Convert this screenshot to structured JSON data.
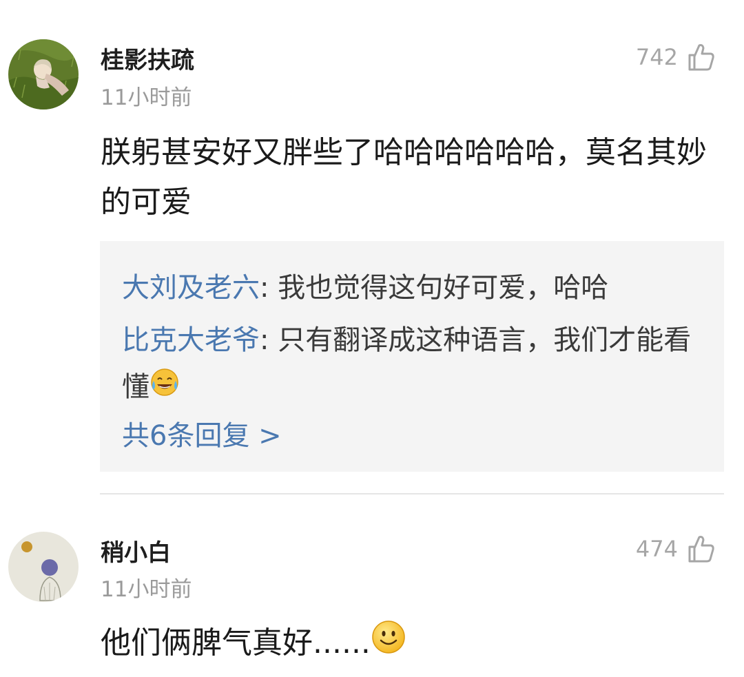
{
  "comments": [
    {
      "username": "桂影扶疏",
      "time": "11小时前",
      "likes": "742",
      "text": "朕躬甚安好又胖些了哈哈哈哈哈哈，莫名其妙的可爱",
      "avatar_icon": "avatar-girl-lying-on-grass",
      "replies": [
        {
          "author": "大刘及老六",
          "text": ": 我也觉得这句好可爱，哈哈"
        },
        {
          "author": "比克大老爷",
          "text": ": 只有翻译成这种语言，我们才能看懂",
          "emoji": "tears-of-joy-emoji"
        }
      ],
      "more_replies": "共6条回复 >"
    },
    {
      "username": "稍小白",
      "time": "11小时前",
      "likes": "474",
      "text": "他们俩脾气真好......",
      "avatar_icon": "avatar-sketch-boy-moon",
      "text_emoji": "smile-emoji"
    }
  ],
  "colors": {
    "link_blue": "#4a78b0",
    "meta_gray": "#9a9a9a",
    "reply_bg": "#f4f4f4"
  },
  "icons": {
    "like": "thumbs-up-outline-icon"
  }
}
